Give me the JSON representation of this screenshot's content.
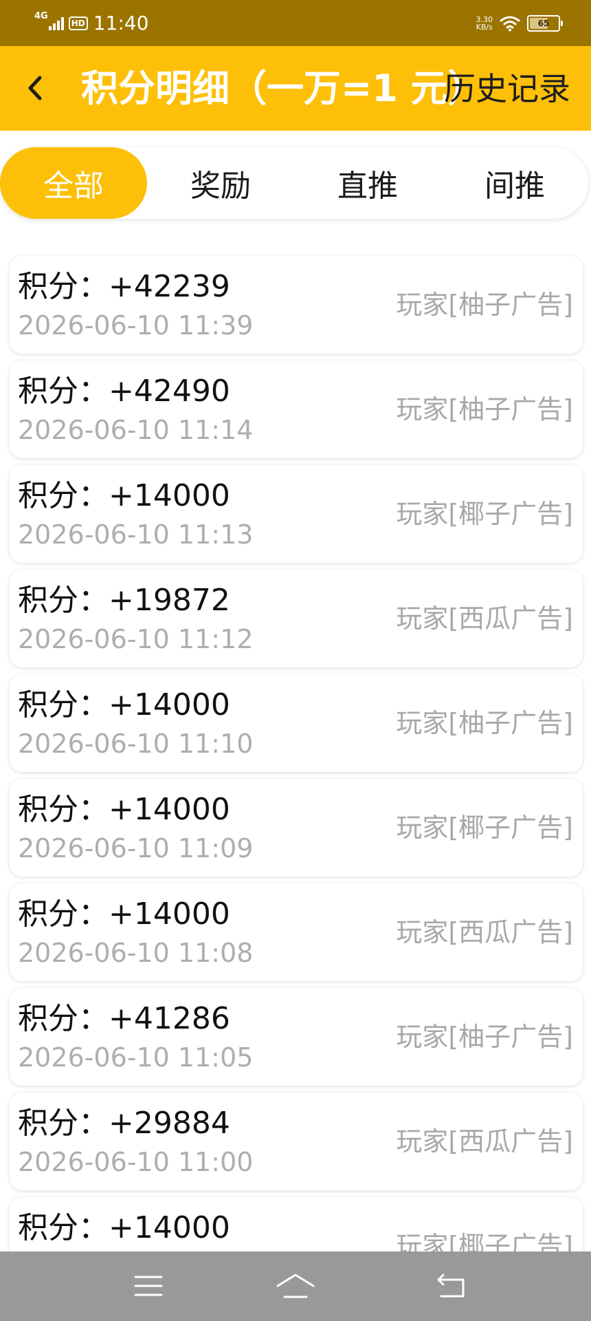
{
  "status_bar": {
    "network": "4G",
    "hd": "HD",
    "time": "11:40",
    "speed_value": "3.30",
    "speed_unit": "KB/s",
    "battery": "65",
    "battery_level": 0.65
  },
  "header": {
    "title": "积分明细（一万=1 元）",
    "history": "历史记录"
  },
  "tabs": [
    {
      "label": "全部",
      "active": true
    },
    {
      "label": "奖励",
      "active": false
    },
    {
      "label": "直推",
      "active": false
    },
    {
      "label": "间推",
      "active": false
    }
  ],
  "records": [
    {
      "points": "积分：+42239",
      "time": "2026-06-10 11:39",
      "source": "玩家[柚子广告]"
    },
    {
      "points": "积分：+42490",
      "time": "2026-06-10 11:14",
      "source": "玩家[柚子广告]"
    },
    {
      "points": "积分：+14000",
      "time": "2026-06-10 11:13",
      "source": "玩家[椰子广告]"
    },
    {
      "points": "积分：+19872",
      "time": "2026-06-10 11:12",
      "source": "玩家[西瓜广告]"
    },
    {
      "points": "积分：+14000",
      "time": "2026-06-10 11:10",
      "source": "玩家[柚子广告]"
    },
    {
      "points": "积分：+14000",
      "time": "2026-06-10 11:09",
      "source": "玩家[椰子广告]"
    },
    {
      "points": "积分：+14000",
      "time": "2026-06-10 11:08",
      "source": "玩家[西瓜广告]"
    },
    {
      "points": "积分：+41286",
      "time": "2026-06-10 11:05",
      "source": "玩家[柚子广告]"
    },
    {
      "points": "积分：+29884",
      "time": "2026-06-10 11:00",
      "source": "玩家[西瓜广告]"
    },
    {
      "points": "积分：+14000",
      "time": "",
      "source": "玩家[椰子广告]"
    }
  ],
  "icons": {
    "back": "chevron-left-icon",
    "menu": "menu-icon",
    "home": "home-icon",
    "return": "return-icon"
  },
  "colors": {
    "status_bar": "#9b7400",
    "accent": "#fdbf08",
    "nav_bar": "#999999"
  }
}
